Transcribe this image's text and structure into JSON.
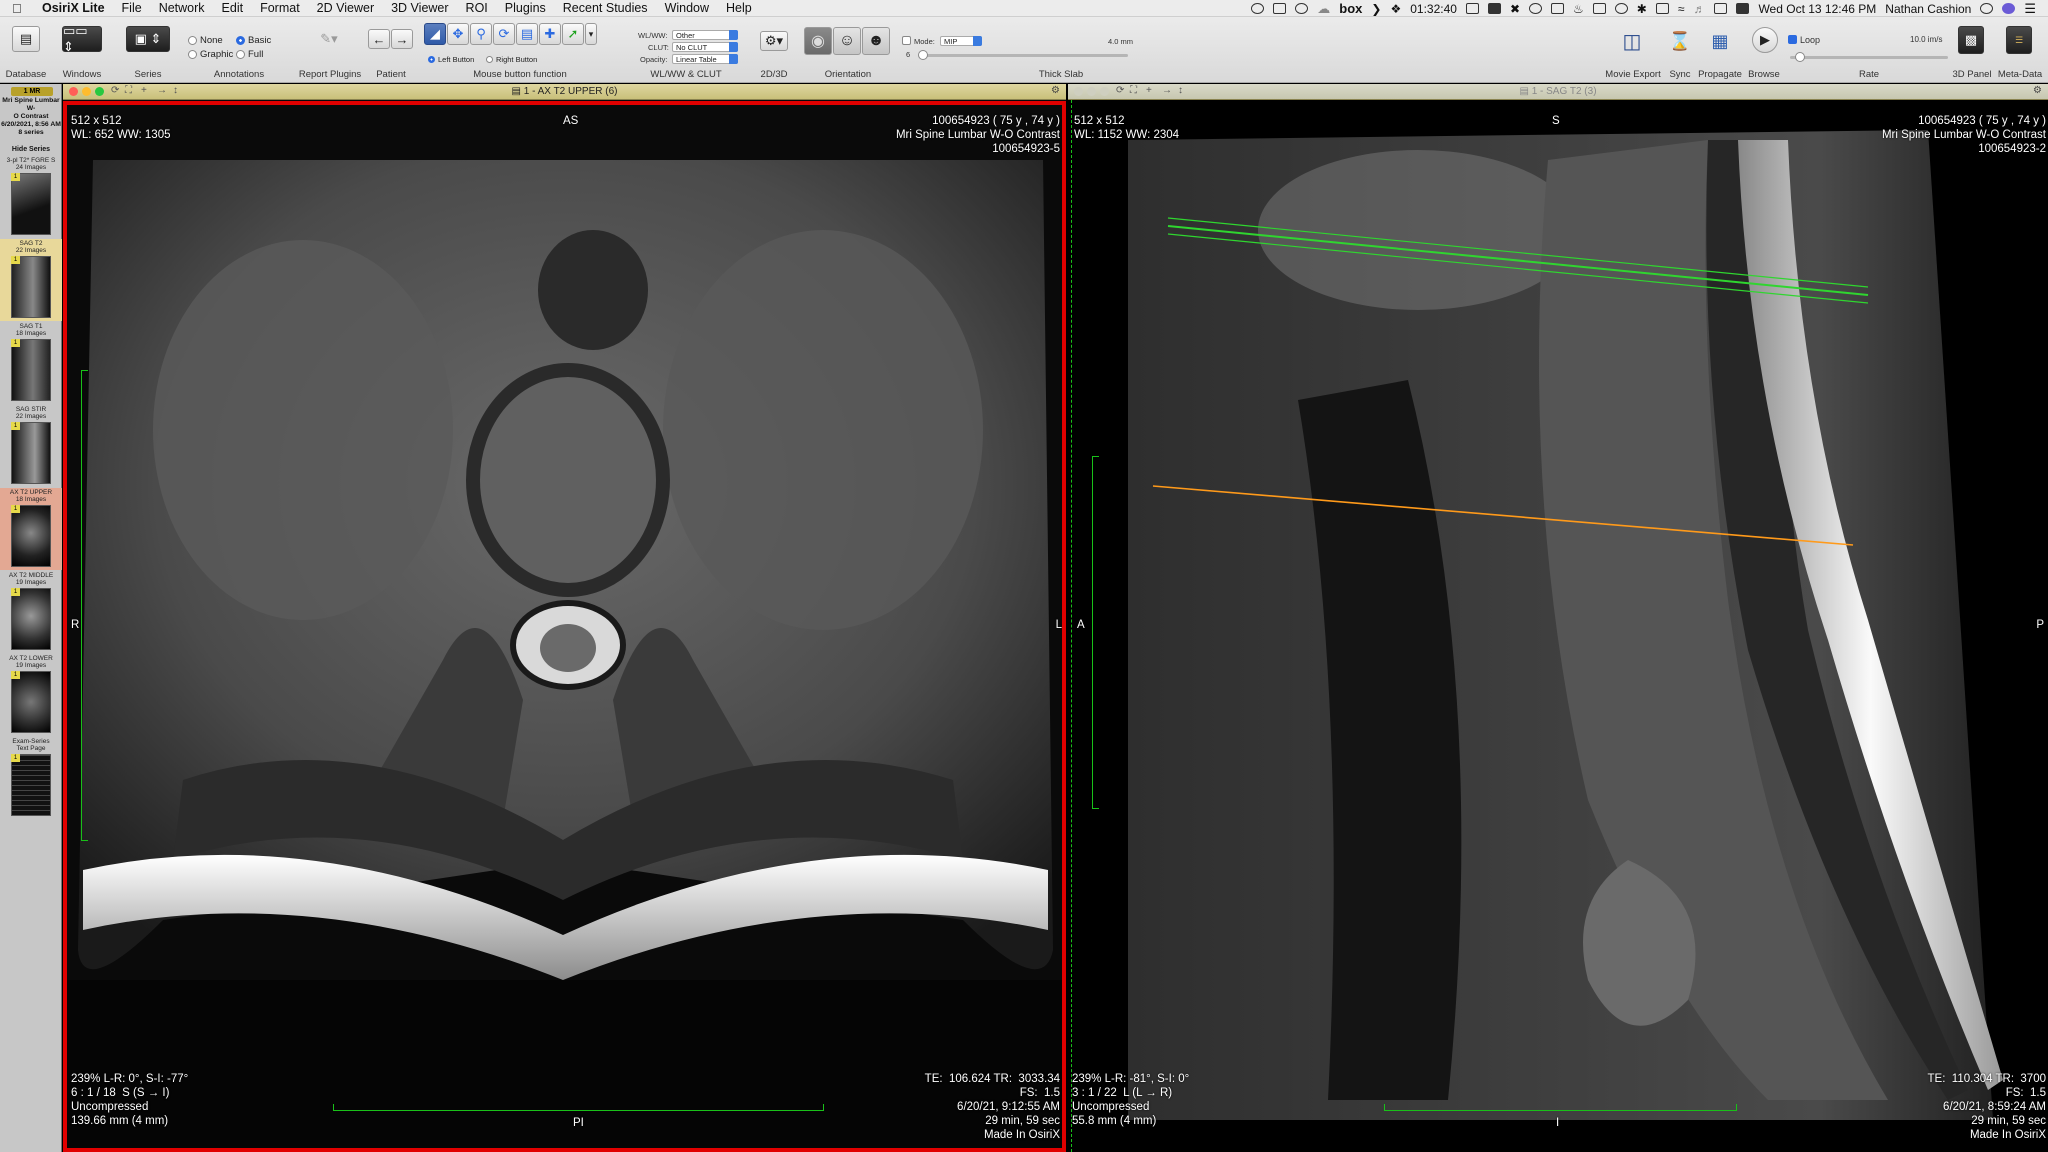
{
  "menubar": {
    "app_name": "OsiriX Lite",
    "items": [
      "File",
      "Network",
      "Edit",
      "Format",
      "2D Viewer",
      "3D Viewer",
      "ROI",
      "Plugins",
      "Recent Studies",
      "Window",
      "Help"
    ],
    "status": {
      "box_label": "box",
      "timer": "01:32:40",
      "datetime": "Wed Oct 13  12:46 PM",
      "user": "Nathan Cashion"
    }
  },
  "toolbar": {
    "labels": {
      "database": "Database",
      "windows": "Windows",
      "series": "Series",
      "annotations": "Annotations",
      "report_plugins": "Report Plugins",
      "patient": "Patient",
      "mouse_button_function": "Mouse button function",
      "wlww_clut": "WL/WW & CLUT",
      "twod_threed": "2D/3D",
      "orientation": "Orientation",
      "thick_slab": "Thick Slab",
      "movie_export": "Movie Export",
      "sync": "Sync",
      "propagate": "Propagate",
      "browse": "Browse",
      "rate": "Rate",
      "threed_panel": "3D Panel",
      "meta_data": "Meta-Data"
    },
    "annotations": {
      "none": "None",
      "graphic": "Graphic",
      "basic": "Basic",
      "full": "Full",
      "selected": "Basic"
    },
    "mouse": {
      "left_button": "Left Button",
      "right_button": "Right Button"
    },
    "wlww": {
      "wlww_label": "WL/WW:",
      "wlww_value": "Other",
      "clut_label": "CLUT:",
      "clut_value": "No CLUT",
      "opacity_label": "Opacity:",
      "opacity_value": "Linear Table"
    },
    "thick_slab": {
      "mode_label": "Mode:",
      "mode_value": "MIP",
      "thickness": "4.0 mm",
      "slab_count": "6"
    },
    "loop_label": "Loop",
    "rate_value": "10.0 im/s"
  },
  "sidebar": {
    "badge": "1 MR",
    "study": [
      "Mri Spine Lumbar W-",
      "O Contrast",
      "6/20/2021, 8:56 AM",
      "8 series"
    ],
    "hide_series": "Hide Series",
    "series": [
      {
        "name": "3-pl T2* FGRE S",
        "count": "24 Images",
        "state": "normal"
      },
      {
        "name": "SAG T2",
        "count": "22 Images",
        "state": "highlight"
      },
      {
        "name": "SAG T1",
        "count": "18 Images",
        "state": "normal"
      },
      {
        "name": "SAG STIR",
        "count": "22 Images",
        "state": "normal"
      },
      {
        "name": "AX T2 UPPER",
        "count": "18 Images",
        "state": "active"
      },
      {
        "name": "AX T2 MIDDLE",
        "count": "19 Images",
        "state": "normal"
      },
      {
        "name": "AX T2 LOWER",
        "count": "19 Images",
        "state": "normal"
      },
      {
        "name": "Exam-Series",
        "count": "Text Page",
        "state": "normal"
      }
    ],
    "thumb_number": "1"
  },
  "viewer_left": {
    "title": "1 - AX T2 UPPER (6)",
    "tl": "512 x 512\nWL: 652 WW: 1305",
    "tr": "100654923 ( 75 y , 74 y )\nMri Spine Lumbar W-O Contrast\n100654923-5",
    "top_orient": "AS",
    "left_orient": "R",
    "right_orient": "L",
    "bottom_orient": "PI",
    "bl": "239% L-R: 0°, S-I: -77°\n6 : 1 / 18  S (S → I)\nUncompressed\n139.66 mm (4 mm)",
    "br": "TE:  106.624 TR:  3033.34\nFS:  1.5\n6/20/21, 9:12:55 AM\n29 min, 59 sec\nMade In OsiriX"
  },
  "viewer_right": {
    "title": "1 - SAG T2 (3)",
    "tl": "512 x 512\nWL: 1152 WW: 2304",
    "tr": "100654923 ( 75 y , 74 y )\nMri Spine Lumbar W-O Contrast\n100654923-2",
    "top_orient": "S",
    "left_orient": "A",
    "right_orient": "P",
    "bottom_orient": "I",
    "bl": "239% L-R: -81°, S-I: 0°\n3 : 1 / 22  L (L → R)\nUncompressed\n55.8 mm (4 mm)",
    "br": "TE:  110.304 TR:  3700\nFS:  1.5\n6/20/21, 8:59:24 AM\n29 min, 59 sec\nMade In OsiriX"
  },
  "colors": {
    "active_frame": "#e10000",
    "ruler": "#19c019",
    "ref_line_green": "#2fd62f",
    "ref_line_orange": "#ff9a1a"
  }
}
